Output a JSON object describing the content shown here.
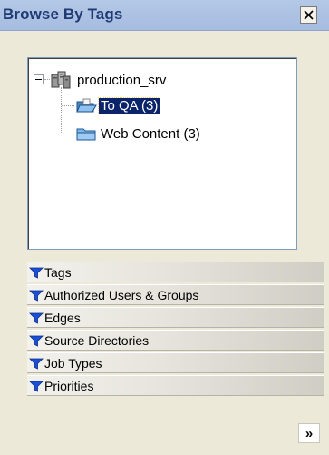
{
  "panel": {
    "title": "Browse By Tags",
    "close_icon": "close-icon"
  },
  "tree": {
    "root": {
      "label": "production_srv",
      "icon": "server-icon",
      "expanded": true
    },
    "children": [
      {
        "label": "To QA (3)",
        "icon": "open-folder-icon",
        "selected": true
      },
      {
        "label": "Web Content (3)",
        "icon": "folder-icon",
        "selected": false
      }
    ]
  },
  "categories": [
    {
      "label": "Tags",
      "icon": "filter-icon"
    },
    {
      "label": "Authorized Users & Groups",
      "icon": "filter-icon"
    },
    {
      "label": "Edges",
      "icon": "filter-icon"
    },
    {
      "label": "Source Directories",
      "icon": "filter-icon"
    },
    {
      "label": "Job Types",
      "icon": "filter-icon"
    },
    {
      "label": "Priorities",
      "icon": "filter-icon"
    }
  ],
  "footer": {
    "more_label": "»",
    "more_icon": "double-chevron-right-icon"
  },
  "colors": {
    "selection": "#0a246a",
    "title_text": "#1f3b73",
    "filter_icon": "#1a4fd8"
  }
}
